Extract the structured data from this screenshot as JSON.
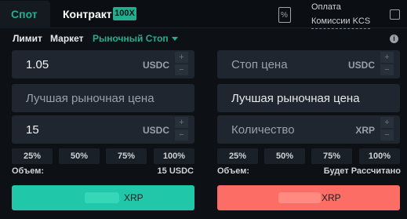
{
  "tabs": {
    "spot": "Спот",
    "contract": "Контракт",
    "badge": "100X"
  },
  "fee": {
    "line1": "Оплата",
    "line2": "Комиссии KCS"
  },
  "order_types": {
    "limit": "Лимит",
    "market": "Маркет",
    "stop_market": "Рыночный Стоп"
  },
  "buy_form": {
    "price_value": "1.05",
    "price_unit": "USDC",
    "market_price_placeholder": "Лучшая рыночная цена",
    "amount_value": "15",
    "amount_unit": "USDC",
    "percents": [
      "25%",
      "50%",
      "75%",
      "100%"
    ],
    "volume_label": "Объем:",
    "volume_value": "15 USDC",
    "button_label": "XRP"
  },
  "sell_form": {
    "stop_price_placeholder": "Стоп цена",
    "stop_price_unit": "USDC",
    "market_price_placeholder": "Лучшая рыночная цена",
    "qty_placeholder": "Количество",
    "qty_unit": "XRP",
    "percents": [
      "25%",
      "50%",
      "75%",
      "100%"
    ],
    "volume_label": "Объем:",
    "volume_value": "Будет Рассчитано",
    "button_label": "XRP"
  },
  "stepper": {
    "plus": "+",
    "minus": "−"
  },
  "icons": {
    "calculator": "percent-calculator-icon",
    "info": "info-icon",
    "dropdown": "chevron-down-icon"
  },
  "colors": {
    "accent": "#24ae8f",
    "buy": "#20c7a9",
    "sell": "#fb6d65"
  }
}
